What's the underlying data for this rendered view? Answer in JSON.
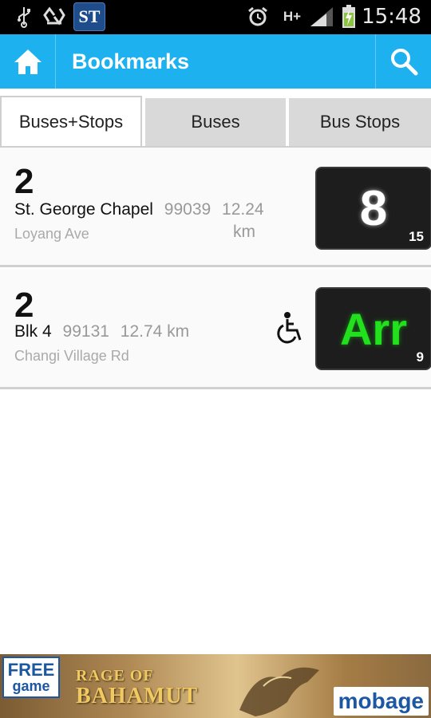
{
  "status_bar": {
    "usb_icon": "usb-icon",
    "recycle_icon": "recycle-icon",
    "app_logo": "ST",
    "alarm_icon": "alarm-icon",
    "network": "H+",
    "signal_icon": "signal-icon",
    "battery_icon": "battery-charging-icon",
    "time": "15:48"
  },
  "action_bar": {
    "title": "Bookmarks",
    "home_icon": "home-icon",
    "search_icon": "search-icon",
    "color": "#1eb1f0"
  },
  "tabs": [
    {
      "label": "Buses+Stops",
      "active": true
    },
    {
      "label": "Buses",
      "active": false
    },
    {
      "label": "Bus Stops",
      "active": false
    }
  ],
  "bookmarks": [
    {
      "route": "2",
      "stop_name": "St. George Chapel",
      "stop_code": "99039",
      "distance_1": "12.24",
      "distance_2": "km",
      "road": "Loyang Ave",
      "eta": "8",
      "eta_next": "15",
      "eta_color": "#ffffff",
      "wheelchair": false
    },
    {
      "route": "2",
      "stop_name": "Blk 4",
      "stop_code": "99131",
      "distance": "12.74 km",
      "road": "Changi Village Rd",
      "eta": "Arr",
      "eta_next": "9",
      "eta_color": "#22e01e",
      "wheelchair": true
    }
  ],
  "ad": {
    "badge_line1": "FREE",
    "badge_line2": "game",
    "title_line1": "RAGE OF",
    "title_line2": "BAHAMUT",
    "brand": "mobage"
  }
}
